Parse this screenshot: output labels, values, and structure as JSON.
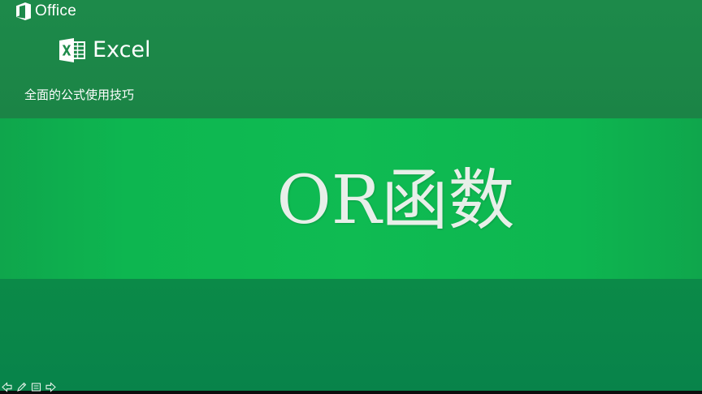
{
  "slide": {
    "office_brand": "Office",
    "excel_brand": "Excel",
    "subtitle": "全面的公式使用技巧",
    "title": "OR函数"
  },
  "icons": {
    "office": "office-logo-icon",
    "excel": "excel-logo-icon",
    "prev": "arrow-left-icon",
    "pen": "pen-icon",
    "menu": "slide-menu-icon",
    "next": "arrow-right-icon"
  },
  "colors": {
    "top_band": "#1d8a4a",
    "middle_band": "#0fbb52",
    "bottom_band": "#0b8a48",
    "text": "#ffffff"
  }
}
